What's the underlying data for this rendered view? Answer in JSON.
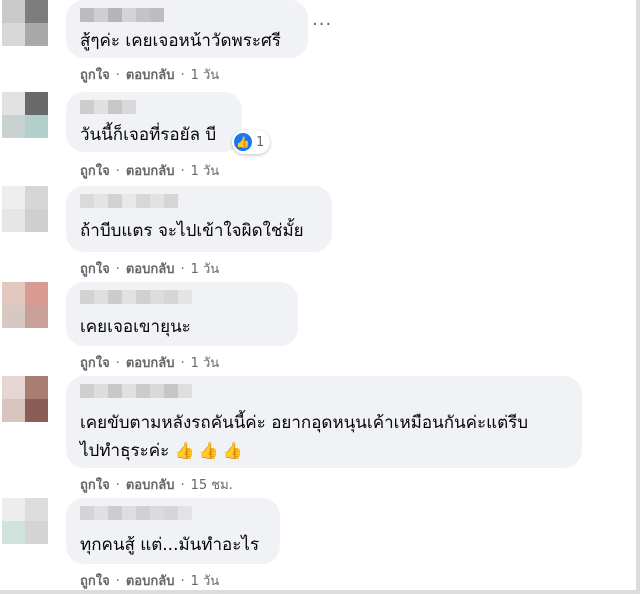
{
  "comments": [
    {
      "text": "สู้ๆค่ะ เคยเจอหน้าวัดพระศรี",
      "like_label": "ถูกใจ",
      "reply_label": "ตอบกลับ",
      "time": "1 วัน"
    },
    {
      "text": "วันนี้ก็เจอที่รอยัล บี",
      "reaction_count": "1",
      "like_label": "ถูกใจ",
      "reply_label": "ตอบกลับ",
      "time": "1 วัน"
    },
    {
      "text": "ถ้าบีบแตร จะไปเข้าใจผิดใช่มั้ย",
      "like_label": "ถูกใจ",
      "reply_label": "ตอบกลับ",
      "time": "1 วัน"
    },
    {
      "text": "เคยเจอเขายุนะ",
      "like_label": "ถูกใจ",
      "reply_label": "ตอบกลับ",
      "time": "1 วัน"
    },
    {
      "text": "เคยขับตามหลังรถคันนี้ค่ะ อยากอุดหนุนเค้าเหมือนกันค่ะแต่รีบ",
      "text_line2": "ไปทำธุระค่ะ",
      "emojis": [
        "👍",
        "👍",
        "👍"
      ],
      "like_label": "ถูกใจ",
      "reply_label": "ตอบกลับ",
      "time": "15 ชม."
    },
    {
      "text": "ทุกคนสู้ แต่...มันทำอะไร",
      "like_label": "ถูกใจ",
      "reply_label": "ตอบกลับ",
      "time": "1 วัน"
    }
  ],
  "more_icon": "more-horizontal-icon",
  "more_glyph": "···",
  "separator": "·",
  "colors": {
    "bubble": "#f0f2f5",
    "meta_text": "#65676b",
    "like_blue": "#1877f2"
  }
}
